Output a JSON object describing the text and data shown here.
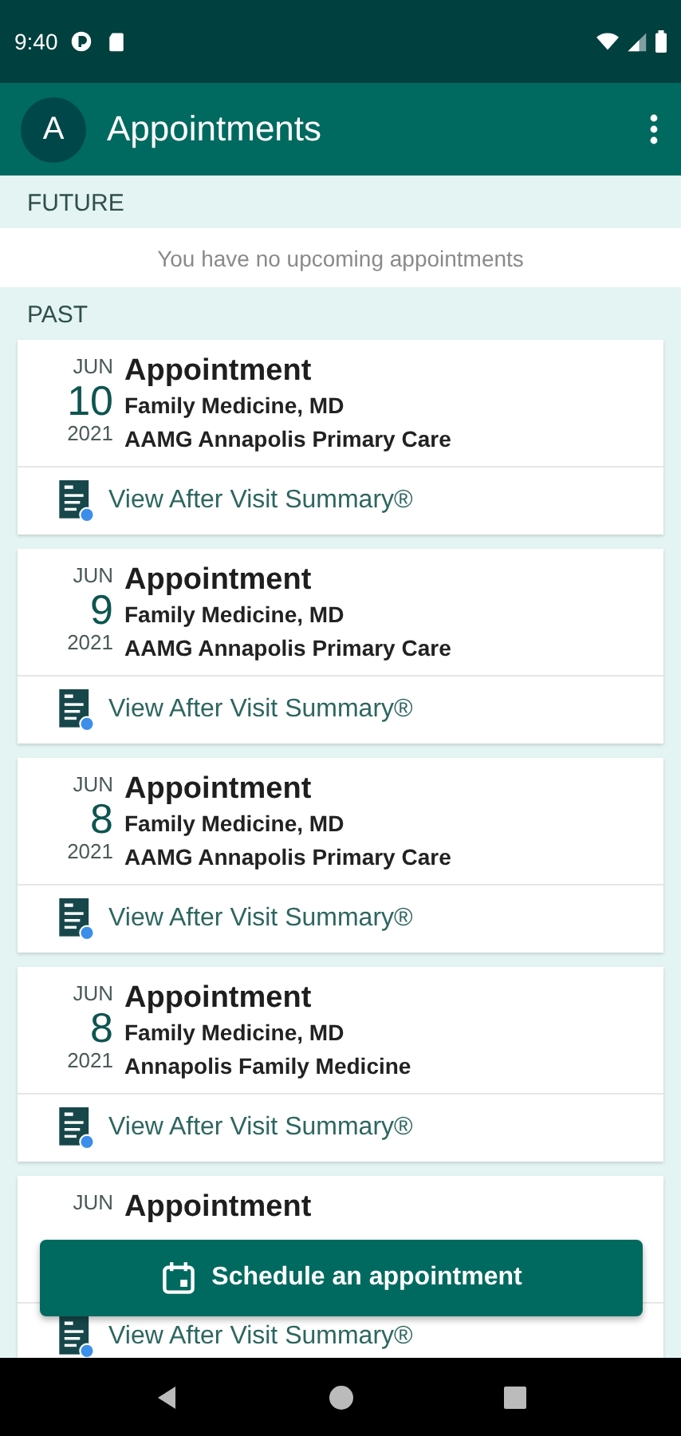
{
  "status_bar": {
    "time": "9:40"
  },
  "app_bar": {
    "avatar": "A",
    "title": "Appointments"
  },
  "sections": [
    {
      "title": "FUTURE",
      "empty_message": "You have no upcoming appointments"
    },
    {
      "title": "PAST",
      "appointments": [
        {
          "month": "JUN",
          "day": "10",
          "year": "2021",
          "title": "Appointment",
          "provider": "Family Medicine, MD",
          "location": "AAMG Annapolis Primary Care",
          "link": "View After Visit Summary®"
        },
        {
          "month": "JUN",
          "day": "9",
          "year": "2021",
          "title": "Appointment",
          "provider": "Family Medicine, MD",
          "location": "AAMG Annapolis Primary Care",
          "link": "View After Visit Summary®"
        },
        {
          "month": "JUN",
          "day": "8",
          "year": "2021",
          "title": "Appointment",
          "provider": "Family Medicine, MD",
          "location": "AAMG Annapolis Primary Care",
          "link": "View After Visit Summary®"
        },
        {
          "month": "JUN",
          "day": "8",
          "year": "2021",
          "title": "Appointment",
          "provider": "Family Medicine, MD",
          "location": "Annapolis Family Medicine",
          "link": "View After Visit Summary®"
        },
        {
          "month": "JUN",
          "title": "Appointment",
          "link": "View After Visit Summary®"
        }
      ]
    }
  ],
  "action_button": {
    "label": "Schedule an appointment"
  }
}
